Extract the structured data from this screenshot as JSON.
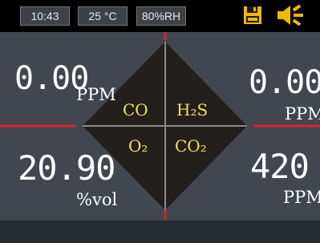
{
  "status": {
    "time": "10:43",
    "temperature": "25 °C",
    "humidity": "80%RH",
    "icons": [
      "save-icon",
      "speaker-icon"
    ],
    "accent_color": "#f5b800"
  },
  "readings": {
    "top_left": {
      "value": "0.00",
      "unit": "PPM"
    },
    "top_right": {
      "value": "0.00",
      "unit": "PPM"
    },
    "bottom_left": {
      "value": "20.90",
      "unit": "%vol"
    },
    "bottom_right": {
      "value": "420",
      "unit": "PPM"
    }
  },
  "gases": {
    "top_left": "CO",
    "top_right": "H₂S",
    "bottom_left": "O₂",
    "bottom_right": "CO₂"
  },
  "colors": {
    "background": "#41464f",
    "diamond": "#231f1c",
    "gas_label": "#f0e25a",
    "divider": "#d8232a",
    "grid": "#8a8a8a"
  }
}
